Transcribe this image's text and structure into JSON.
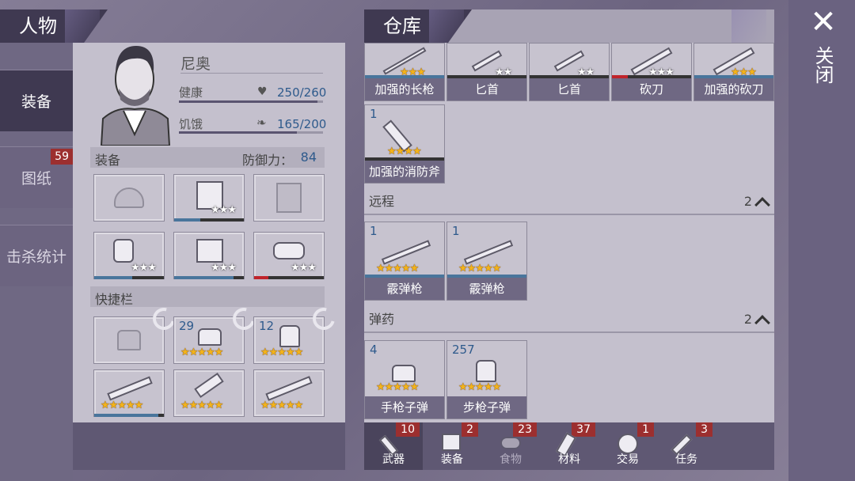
{
  "left_panel": {
    "title": "人物",
    "tabs": [
      {
        "label": "装备"
      },
      {
        "label": "图纸",
        "badge": "59"
      },
      {
        "label": "击杀统计"
      }
    ]
  },
  "character": {
    "name": "尼奥",
    "health_label": "健康",
    "health_value": "250/260",
    "health_fraction": 0.96,
    "hunger_label": "饥饿",
    "hunger_value": "165/200",
    "hunger_fraction": 0.82
  },
  "equipment": {
    "label": "装备",
    "defense_label": "防御力：",
    "defense_value": "84"
  },
  "hotbar": {
    "label": "快捷栏",
    "slot2_count": "29",
    "slot3_count": "12"
  },
  "storage": {
    "title": "仓库",
    "melee_items": [
      {
        "label": "加强的长枪",
        "stars": "★★★"
      },
      {
        "label": "匕首",
        "stars": "★★"
      },
      {
        "label": "匕首",
        "stars": "★★"
      },
      {
        "label": "砍刀",
        "stars": "★★★"
      },
      {
        "label": "加强的砍刀",
        "stars": "★★★"
      }
    ],
    "axe_item": {
      "count": "1",
      "label": "加强的消防斧",
      "stars": "★★★★"
    },
    "ranged_section": {
      "label": "远程",
      "count": "2"
    },
    "ranged_items": [
      {
        "count": "1",
        "label": "霰弹枪",
        "stars": "★★★★★"
      },
      {
        "count": "1",
        "label": "霰弹枪",
        "stars": "★★★★★"
      }
    ],
    "ammo_section": {
      "label": "弹药",
      "count": "2"
    },
    "ammo_items": [
      {
        "count": "4",
        "label": "手枪子弹",
        "stars": "★★★★★"
      },
      {
        "count": "257",
        "label": "步枪子弹",
        "stars": "★★★★★"
      }
    ],
    "categories": [
      {
        "label": "武器",
        "badge": "10"
      },
      {
        "label": "装备",
        "badge": "2"
      },
      {
        "label": "食物",
        "badge": "23"
      },
      {
        "label": "材料",
        "badge": "37"
      },
      {
        "label": "交易",
        "badge": "1"
      },
      {
        "label": "任务",
        "badge": "3"
      }
    ]
  },
  "close": {
    "label": "关闭",
    "icon": "close-icon"
  },
  "stars": {
    "two": "★★",
    "three": "★★★",
    "five": "★★★★★"
  }
}
